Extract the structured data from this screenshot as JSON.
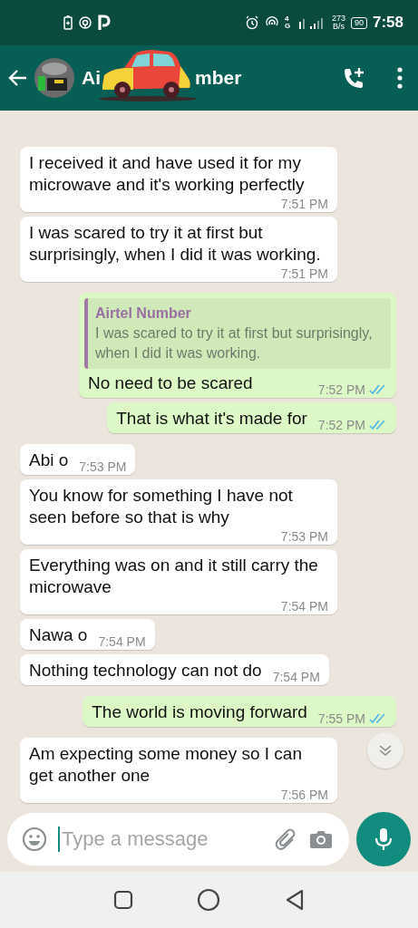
{
  "status_bar": {
    "time": "7:58",
    "net_speed": "273",
    "net_speed_unit": "B/s",
    "battery": "90",
    "network_type": "4G"
  },
  "header": {
    "title_start": "Ai",
    "title_end": "mber"
  },
  "messages": [
    {
      "kind": "incoming",
      "text": "I received it and have used it for my microwave and it's working perfectly",
      "time": "7:51 PM"
    },
    {
      "kind": "incoming",
      "text": "I was scared to try it at first but surprisingly, when I did it was working.",
      "time": "7:51 PM"
    },
    {
      "kind": "outgoing",
      "quote": {
        "author": "Airtel Number",
        "text": "I was scared to try it at first but surprisingly, when I did it was working."
      },
      "text": "No need to be scared",
      "time": "7:52 PM",
      "read": true
    },
    {
      "kind": "outgoing",
      "text": "That is what it's made for",
      "time": "7:52 PM",
      "read": true
    },
    {
      "kind": "incoming",
      "text": "Abi o",
      "time": "7:53 PM"
    },
    {
      "kind": "incoming",
      "text": "You know for something I have not seen before so that is why",
      "time": "7:53 PM"
    },
    {
      "kind": "incoming",
      "text": "Everything was on and it still carry the microwave",
      "time": "7:54 PM"
    },
    {
      "kind": "incoming",
      "text": "Nawa o",
      "time": "7:54 PM"
    },
    {
      "kind": "incoming",
      "text": "Nothing technology can not do",
      "time": "7:54 PM"
    },
    {
      "kind": "outgoing",
      "text": "The world is moving forward",
      "time": "7:55 PM",
      "read": true
    },
    {
      "kind": "incoming",
      "text": "Am expecting some money so I can get another one",
      "time": "7:56 PM"
    }
  ],
  "composer": {
    "placeholder": "Type a message"
  }
}
